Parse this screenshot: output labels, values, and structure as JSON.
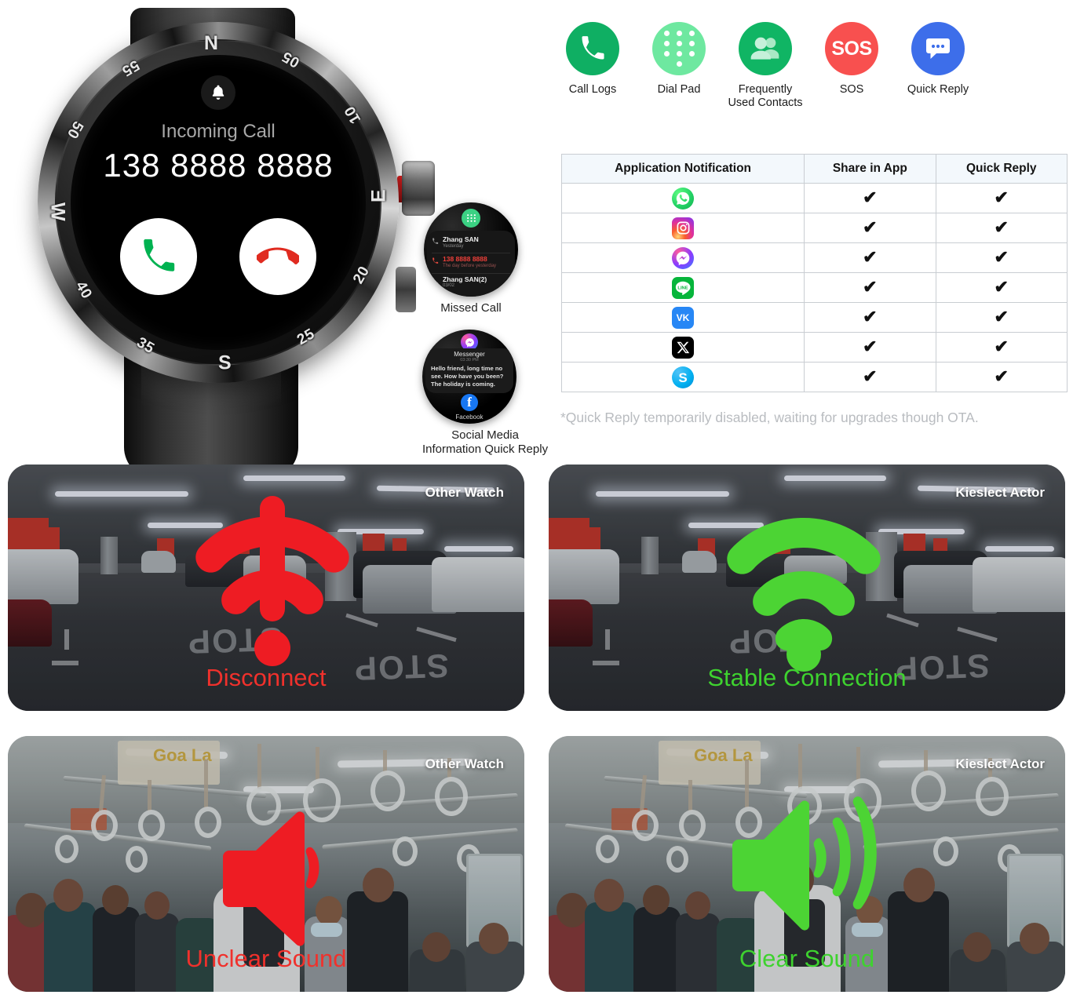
{
  "watch": {
    "screen": {
      "bell_icon": "bell-icon",
      "status": "Incoming Call",
      "number": "138 8888 8888",
      "accept_icon": "phone-accept-icon",
      "decline_icon": "phone-decline-icon"
    },
    "bezel": {
      "directions": [
        "N",
        "E",
        "S",
        "W"
      ],
      "numbers": [
        "05",
        "10",
        "20",
        "25",
        "35",
        "40",
        "50",
        "55"
      ]
    }
  },
  "missed_call": {
    "caption": "Missed Call",
    "dialpad_icon": "dialpad-icon",
    "rows": [
      {
        "name": "Zhang SAN",
        "sub": "Yesterday",
        "missed": false
      },
      {
        "name": "138 8888 8888",
        "sub": "The day before yesterday",
        "missed": true
      },
      {
        "name": "Zhang SAN(2)",
        "sub": "03/02",
        "missed": false
      }
    ]
  },
  "social_quick_reply": {
    "caption_line1": "Social Media",
    "caption_line2": "Information Quick Reply",
    "app": "Messenger",
    "time": "03:30 PM",
    "message": "Hello friend, long time no see. How have you been? The holiday is coming.",
    "footer_app": "Facebook",
    "footer_icon": "facebook-icon",
    "header_icon": "messenger-icon"
  },
  "features": [
    {
      "label": "Call Logs",
      "icon": "phone-icon",
      "color": "#0FAF63"
    },
    {
      "label": "Dial Pad",
      "icon": "dialpad-icon",
      "color": "#6EE8A0"
    },
    {
      "label": "Frequently\nUsed Contacts",
      "label_line1": "Frequently",
      "label_line2": "Used Contacts",
      "icon": "contacts-icon",
      "color": "#10B564"
    },
    {
      "label": "SOS",
      "icon": "sos-icon",
      "color": "#F8504F"
    },
    {
      "label": "Quick Reply",
      "icon": "chat-bubble-icon",
      "color": "#3D6EEA"
    }
  ],
  "table": {
    "headers": [
      "Application Notification",
      "Share in App",
      "Quick Reply"
    ],
    "tick": "✔",
    "rows": [
      {
        "app": "WhatsApp",
        "icon": "whatsapp-icon",
        "share_in_app": "✔",
        "quick_reply": "✔"
      },
      {
        "app": "Instagram",
        "icon": "instagram-icon",
        "share_in_app": "✔",
        "quick_reply": "✔"
      },
      {
        "app": "Messenger",
        "icon": "messenger-icon",
        "share_in_app": "✔",
        "quick_reply": "✔"
      },
      {
        "app": "LINE",
        "icon": "line-icon",
        "share_in_app": "✔",
        "quick_reply": "✔"
      },
      {
        "app": "VK",
        "icon": "vk-icon",
        "share_in_app": "✔",
        "quick_reply": "✔"
      },
      {
        "app": "X",
        "icon": "x-icon",
        "share_in_app": "✔",
        "quick_reply": "✔"
      },
      {
        "app": "Skype",
        "icon": "skype-icon",
        "share_in_app": "✔",
        "quick_reply": "✔"
      }
    ],
    "footnote": "*Quick Reply temporarily disabled, waiting for upgrades though OTA."
  },
  "panels": [
    {
      "label": "Other Watch",
      "caption": "Disconnect",
      "caption_color": "#f0312c",
      "scene": "garage",
      "icon": "wifi-disconnected-icon"
    },
    {
      "label": "Kieslect Actor",
      "caption": "Stable Connection",
      "caption_color": "#3ed22f",
      "scene": "garage",
      "icon": "wifi-connected-icon"
    },
    {
      "label": "Other Watch",
      "caption": "Unclear Sound",
      "caption_color": "#f0312c",
      "scene": "train",
      "icon": "speaker-low-icon"
    },
    {
      "label": "Kieslect Actor",
      "caption": "Clear Sound",
      "caption_color": "#3ed22f",
      "scene": "train",
      "icon": "speaker-high-icon"
    }
  ]
}
